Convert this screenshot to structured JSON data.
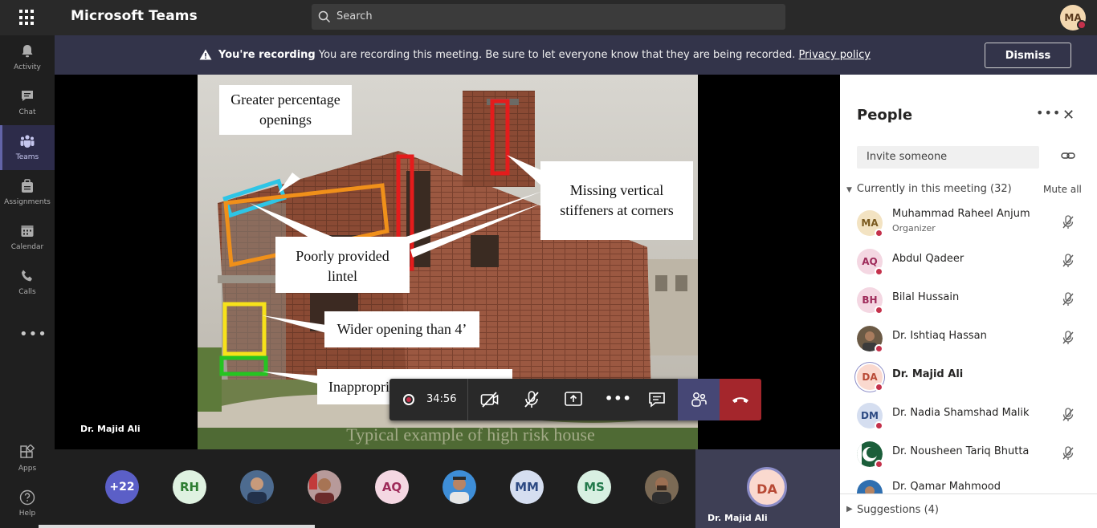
{
  "app": {
    "title": "Microsoft Teams",
    "search_placeholder": "Search",
    "user_initials": "MA"
  },
  "rail": {
    "items": [
      {
        "label": "Activity",
        "icon": "bell-icon"
      },
      {
        "label": "Chat",
        "icon": "chat-icon"
      },
      {
        "label": "Teams",
        "icon": "teams-icon",
        "active": true
      },
      {
        "label": "Assignments",
        "icon": "assignments-icon"
      },
      {
        "label": "Calendar",
        "icon": "calendar-icon"
      },
      {
        "label": "Calls",
        "icon": "phone-icon"
      }
    ],
    "more": "•••",
    "apps_label": "Apps",
    "help_label": "Help"
  },
  "banner": {
    "bold": "You're recording",
    "text": "You are recording this meeting. Be sure to let everyone know that they are being recorded.",
    "link": "Privacy policy",
    "dismiss": "Dismiss"
  },
  "slide": {
    "callouts": [
      "Greater percentage openings",
      "Missing vertical stiffeners at corners",
      "Poorly provided lintel",
      "Wider opening than 4’",
      "Inappropriate vertical gap"
    ],
    "caption": "Typical example of high risk house"
  },
  "stage": {
    "presenter": "Dr. Majid Ali"
  },
  "controls": {
    "timer": "34:56"
  },
  "strip": {
    "overflow": "+22",
    "tiles": [
      {
        "initials": "RH",
        "bg": "#dff2e1",
        "fg": "#2e7d32"
      },
      {
        "initials": "",
        "photo": true
      },
      {
        "initials": "",
        "photo": true
      },
      {
        "initials": "AQ",
        "bg": "#f4d7e2",
        "fg": "#9e2b5a"
      },
      {
        "initials": "",
        "photo": true
      },
      {
        "initials": "MM",
        "bg": "#d5def0",
        "fg": "#2d4a83"
      },
      {
        "initials": "MS",
        "bg": "#d8f0e2",
        "fg": "#237a4c"
      },
      {
        "initials": "",
        "photo": true
      }
    ],
    "self_initials": "DA",
    "self_name": "Dr. Majid Ali"
  },
  "people": {
    "title": "People",
    "invite_placeholder": "Invite someone",
    "section": "Currently in this meeting (32)",
    "mute_all": "Mute all",
    "participants": [
      {
        "name": "Muhammad Raheel Anjum",
        "role": "Organizer",
        "initials": "MA",
        "bg": "#f3e3c2",
        "fg": "#7a5a1f"
      },
      {
        "name": "Abdul Qadeer",
        "role": "",
        "initials": "AQ",
        "bg": "#f4d7e2",
        "fg": "#9e2b5a"
      },
      {
        "name": "Bilal Hussain",
        "role": "",
        "initials": "BH",
        "bg": "#f4d7e2",
        "fg": "#9e2b5a"
      },
      {
        "name": "Dr. Ishtiaq Hassan",
        "role": "",
        "initials": "",
        "photo": true
      },
      {
        "name": "Dr. Majid Ali",
        "role": "",
        "initials": "DA",
        "bg": "#fad9cf",
        "fg": "#b84a36",
        "me": true
      },
      {
        "name": "Dr. Nadia Shamshad Malik",
        "role": "",
        "initials": "DM",
        "bg": "#d5def0",
        "fg": "#2d4a83"
      },
      {
        "name": "Dr. Nousheen Tariq Bhutta",
        "role": "",
        "initials": "",
        "photo": true
      },
      {
        "name": "Dr. Qamar Mahmood",
        "role": "",
        "initials": "",
        "photo": true
      }
    ],
    "suggestions": "Suggestions (4)"
  }
}
